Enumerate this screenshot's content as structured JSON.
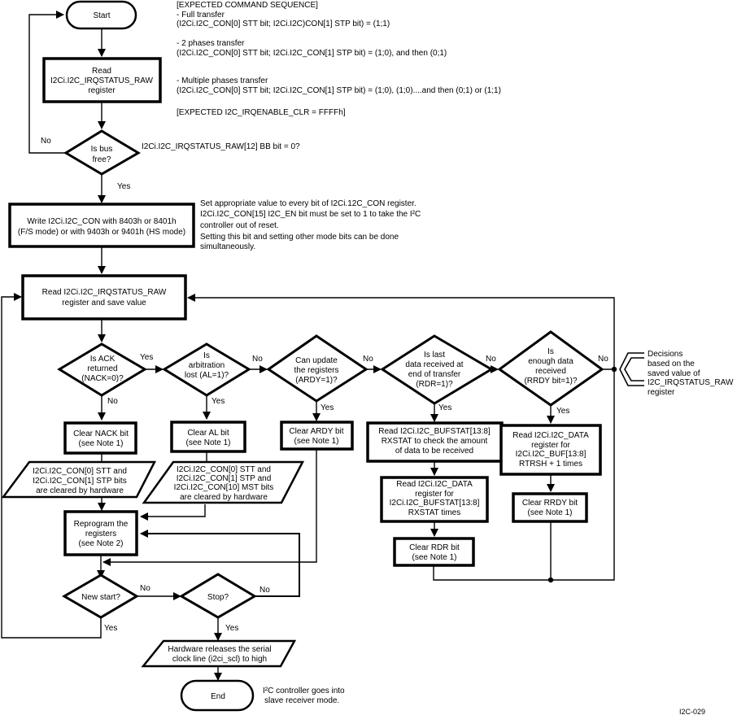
{
  "figure_id": "I2C-029",
  "nodes": {
    "start": "Start",
    "read_raw": [
      "Read",
      "I2Ci.I2C_IRQSTATUS_RAW",
      "register"
    ],
    "bus_free": [
      "Is bus",
      "free?"
    ],
    "write_con": [
      "Write I2Ci.I2C_CON with 8403h or 8401h",
      "(F/S mode) or with 9403h or 9401h (HS mode)"
    ],
    "read_save": [
      "Read I2Ci.I2C_IRQSTATUS_RAW",
      "register and save value"
    ],
    "ack": [
      "Is ACK",
      "returned",
      "(NACK=0)?"
    ],
    "arb": [
      "Is",
      "arbitration",
      "lost (AL=1)?"
    ],
    "ardy": [
      "Can update",
      "the registers",
      "(ARDY=1)?"
    ],
    "rdr": [
      "Is last",
      "data received at",
      "end of transfer",
      "(RDR=1)?"
    ],
    "rrdy": [
      "Is",
      "enough data",
      "received",
      "(RRDY bit=1)?"
    ],
    "clear_nack": [
      "Clear NACK bit",
      "(see Note 1)"
    ],
    "clear_al": [
      "Clear AL bit",
      "(see Note 1)"
    ],
    "clear_ardy": [
      "Clear ARDY bit",
      "(see Note 1)"
    ],
    "read_bufstat": [
      "Read I2Ci.I2C_BUFSTAT[13:8]",
      "RXSTAT to check the amount",
      "of data to be received"
    ],
    "read_data_rxstat": [
      "Read I2Ci.I2C_DATA",
      "register for",
      "I2Ci.I2C_BUFSTAT[13:8]",
      "RXSTAT times"
    ],
    "clear_rdr": [
      "Clear RDR bit",
      "(see Note 1)"
    ],
    "read_data_rtrsh": [
      "Read I2Ci.I2C_DATA",
      "register for",
      "I2Ci.I2C_BUF[13:8]",
      "RTRSH + 1 times"
    ],
    "clear_rrdy": [
      "Clear RRDY bit",
      "(see Note 1)"
    ],
    "hw_nack": [
      "I2Ci.I2C_CON[0] STT and",
      "I2Ci.I2C_CON[1] STP bits",
      "are cleared by hardware"
    ],
    "hw_al": [
      "I2Ci.I2C_CON[0] STT and",
      "I2Ci.I2C_CON[1] STP and",
      "I2Ci.I2C_CON[10] MST bits",
      "are cleared by hardware"
    ],
    "reprogram": [
      "Reprogram the",
      "registers",
      "(see Note 2)"
    ],
    "new_start": "New start?",
    "stop": "Stop?",
    "hw_release": [
      "Hardware releases the serial",
      "clock line (i2ci_scl) to high"
    ],
    "end": "End"
  },
  "labels": {
    "yes": "Yes",
    "no": "No"
  },
  "annotations": {
    "expected_sequence": [
      "[EXPECTED COMMAND SEQUENCE]",
      "- Full transfer",
      "(I2Ci.I2C_CON[0] STT bit; I2Ci.I2C)CON[1] STP bit) = (1;1)",
      "",
      "- 2 phases transfer",
      "(I2Ci.I2C_CON[0] STT bit; I2Ci.I2C_CON[1] STP bit) = (1;0), and then (0;1)",
      "",
      "",
      "- Multiple phases transfer",
      "(I2Ci.I2C_CON[0] STT bit; I2Ci.I2C_CON[1] STP bit) = (1;0), (1;0)....and then (0;1) or (1;1)",
      "",
      "[EXPECTED I2C_IRQENABLE_CLR = FFFFh]"
    ],
    "bus_condition": "I2Ci.I2C_IRQSTATUS_RAW[12] BB bit = 0?",
    "con_note": [
      "Set appropriate value to every bit of I2Ci.12C_CON register.",
      "I2Ci.I2C_CON[15] I2C_EN bit must be set to 1 to take the I²C",
      "controller out of reset.",
      "Setting this bit and setting other mode bits can be done",
      "simultaneously."
    ],
    "decisions_note": [
      "Decisions",
      "based on the",
      "saved value of",
      "I2C_IRQSTATUS_RAW",
      "register"
    ],
    "end_note": [
      "I²C controller goes into",
      "slave receiver mode."
    ]
  }
}
